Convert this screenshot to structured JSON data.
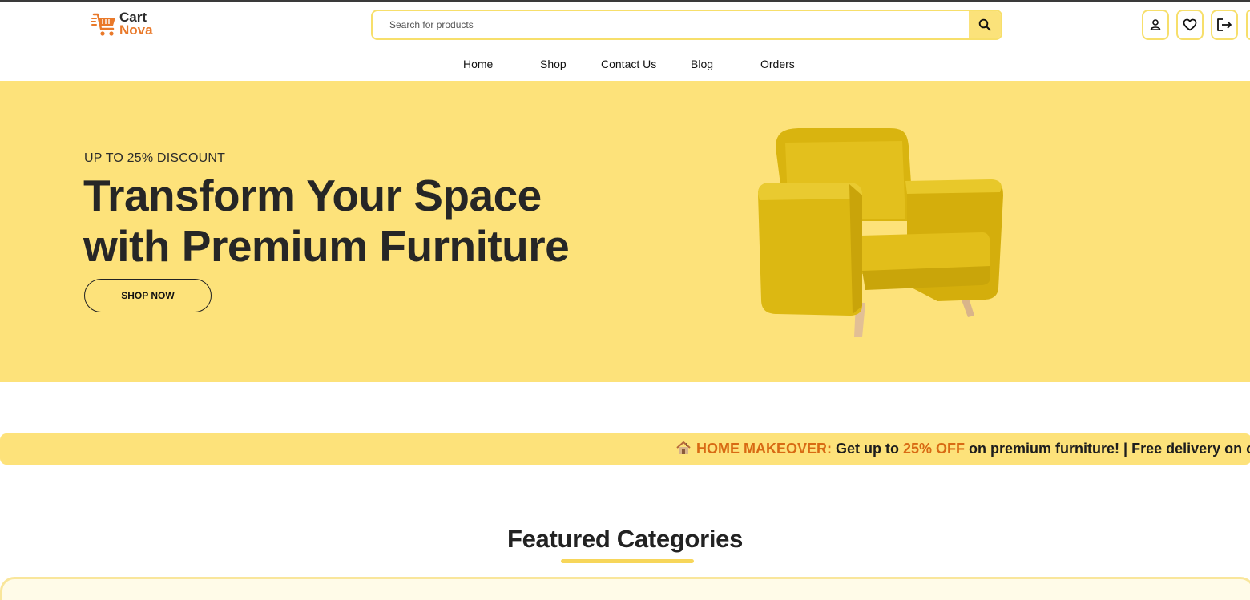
{
  "header": {
    "logo": {
      "line1": "Cart",
      "line2": "Nova",
      "icon": "cart-icon"
    },
    "search": {
      "placeholder": "Search for products",
      "value": "",
      "button_icon": "search-icon"
    },
    "actions": [
      {
        "name": "account",
        "icon": "user-icon"
      },
      {
        "name": "wishlist",
        "icon": "heart-icon"
      },
      {
        "name": "logout",
        "icon": "logout-icon"
      }
    ]
  },
  "nav": {
    "items": [
      "Home",
      "Shop",
      "Contact Us",
      "Blog",
      "Orders"
    ]
  },
  "hero": {
    "kicker": "UP TO 25% DISCOUNT",
    "title_line1": "Transform Your Space",
    "title_line2": "with Premium Furniture",
    "cta": "SHOP NOW",
    "image": "yellow-armchair"
  },
  "promo_strip": {
    "icon": "house-icon",
    "label": "HOME MAKEOVER:",
    "text1": " Get up to ",
    "highlight": "25% OFF",
    "text2": " on premium furniture!  |  Free delivery on o"
  },
  "featured": {
    "title": "Featured Categories"
  },
  "colors": {
    "accent_yellow": "#fde27a",
    "border_yellow": "#f7df6b",
    "brand_orange": "#e9792a",
    "highlight_orange": "#d86a13"
  }
}
